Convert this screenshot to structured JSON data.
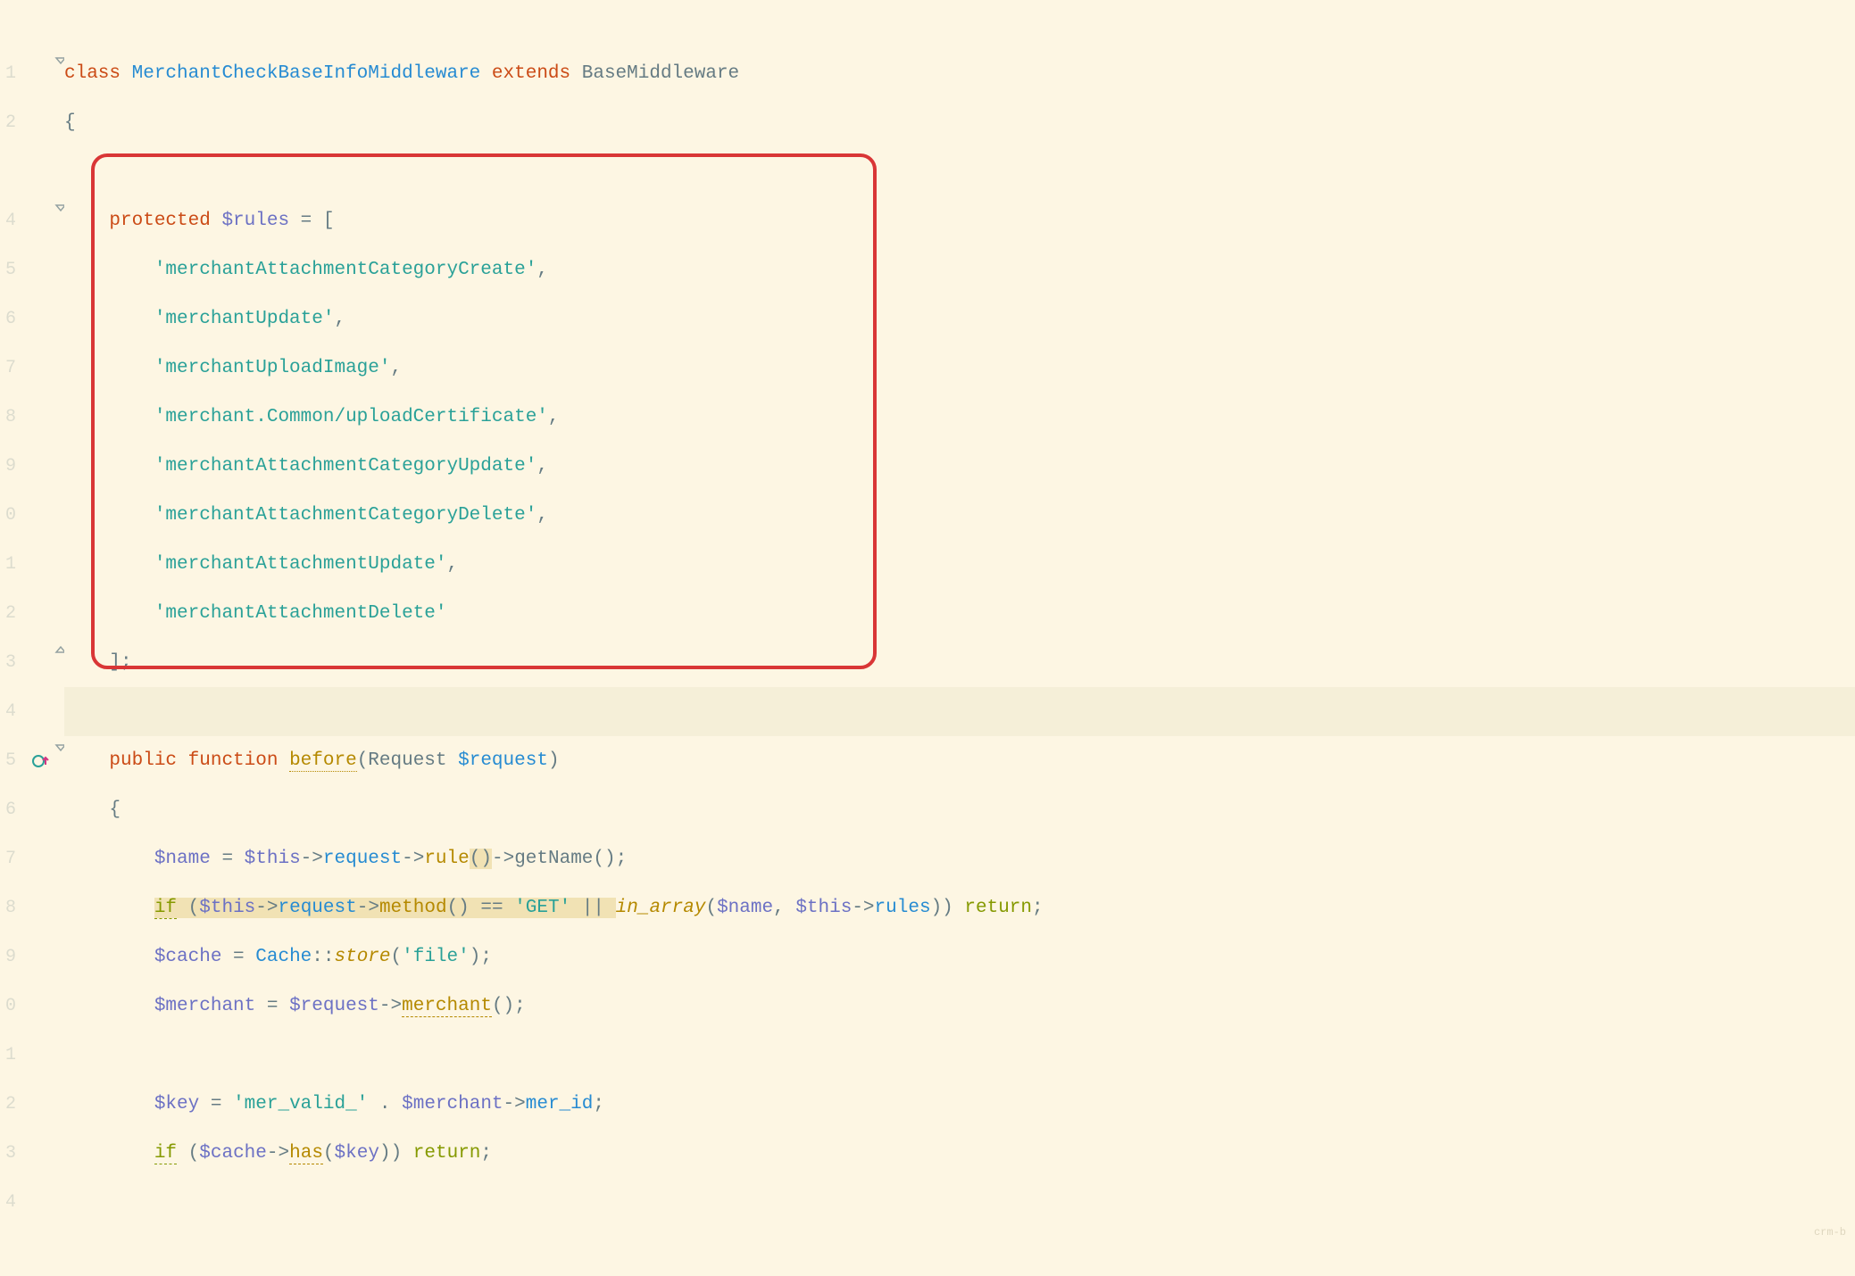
{
  "line_tails": [
    "",
    "1",
    "2",
    "",
    "4",
    "5",
    "6",
    "7",
    "8",
    "9",
    "0",
    "1",
    "2",
    "3",
    "4",
    "5",
    "6",
    "7",
    "8",
    "9",
    "0",
    "1",
    "2",
    "3",
    "4",
    ""
  ],
  "c": {
    "class_kw": "class ",
    "class_name": "MerchantCheckBaseInfoMiddleware",
    "extends_kw": "extends ",
    "base_class": "BaseMiddleware",
    "obrace": "{",
    "protected_kw": "protected ",
    "rules_var": "$rules",
    "eq_arr": " = [",
    "r1": "'merchantAttachmentCategoryCreate'",
    "r2": "'merchantUpdate'",
    "r3": "'merchantUploadImage'",
    "r4": "'merchant.Common/uploadCertificate'",
    "r5": "'merchantAttachmentCategoryUpdate'",
    "r6": "'merchantAttachmentCategoryDelete'",
    "r7": "'merchantAttachmentUpdate'",
    "r8": "'merchantAttachmentDelete'",
    "close_arr": "];",
    "public_kw": "public ",
    "function_kw": "function ",
    "fn_before": "before",
    "request_type": "Request ",
    "request_param": "$request",
    "name_var": "$name",
    "this": "$this",
    "arrow": "->",
    "request_prop": "request",
    "rule_call": "rule",
    "getName_call": "getName",
    "if_kw": "if",
    "method_call": "method",
    "eqeq": " == ",
    "get_str": "'GET'",
    "or": " || ",
    "in_array": "in_array",
    "rules_prop": "rules",
    "return_kw": "return",
    "cache_var": "$cache",
    "cache_cls": "Cache",
    "dcolon": "::",
    "store_call": "store",
    "file_str": "'file'",
    "merchant_var": "$merchant",
    "merchant_call": "merchant",
    "key_var": "$key",
    "key_prefix": "'mer_valid_'",
    "concat": " . ",
    "mer_id": "mer_id",
    "has_call": "has",
    "comma": ",",
    "oparen": "(",
    "cparen": ")",
    "semi": ";",
    "sp": " ",
    "eq": " = "
  },
  "watermark": "crm-b"
}
